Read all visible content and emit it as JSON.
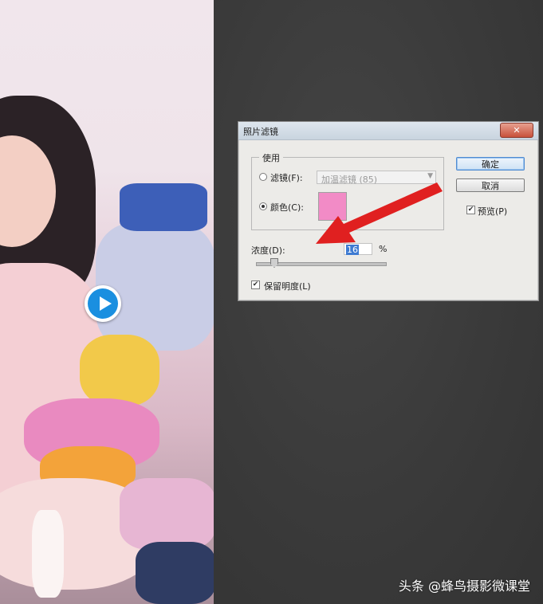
{
  "dialog": {
    "title": "照片滤镜",
    "close_icon": "close-icon",
    "use_group_label": "使用",
    "filter_radio_label": "滤镜(F):",
    "filter_value": "加温滤镜 (85)",
    "color_radio_label": "颜色(C):",
    "selected_option": "color",
    "color_swatch": "#f28bc6",
    "density_label": "浓度(D):",
    "density_value": "16",
    "density_unit": "%",
    "density_slider_fraction": 0.16,
    "preserve_luminosity_label": "保留明度(L)",
    "preserve_luminosity_checked": true,
    "ok_label": "确定",
    "cancel_label": "取消",
    "preview_label": "预览(P)",
    "preview_checked": true
  },
  "annotation": {
    "arrow_color": "#e02020"
  },
  "overlay": {
    "play_icon": "play-icon",
    "watermark": "头条 @蜂鸟摄影微课堂"
  }
}
